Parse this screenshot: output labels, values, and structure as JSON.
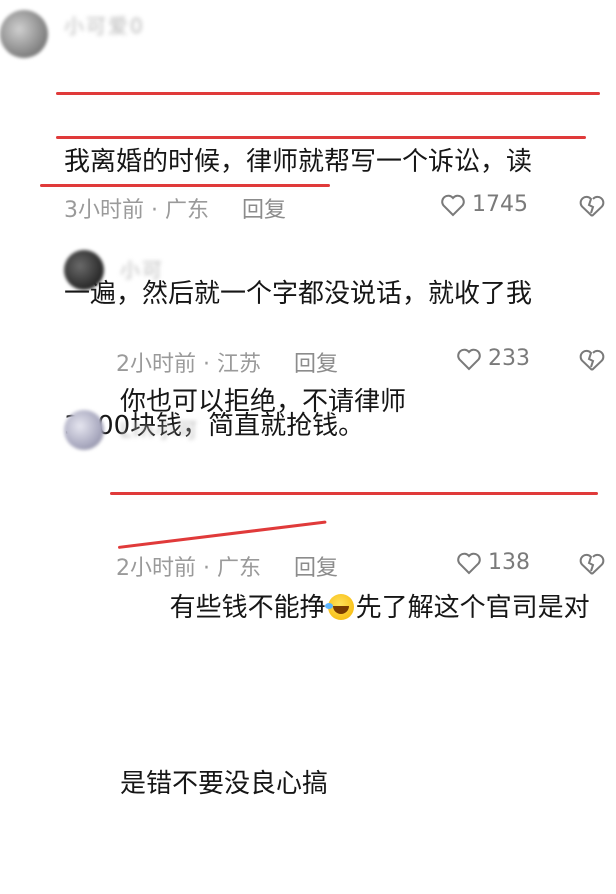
{
  "comments": [
    {
      "username": "小可爱0",
      "lines": [
        "我离婚的时候，律师就帮写一个诉讼，读",
        "一遍，然后就一个字都没说话，就收了我",
        "3000块钱，简直就抢钱。"
      ],
      "time": "3小时前",
      "location": "广东",
      "reply_label": "回复",
      "likes": "1745"
    },
    {
      "username": "小可",
      "lines": [
        "你也可以拒绝，不请律师"
      ],
      "time": "2小时前",
      "location": "江苏",
      "reply_label": "回复",
      "likes": "233"
    },
    {
      "username": "Lln小可",
      "lines_part1": "有些钱不能挣",
      "lines_part2": "先了解这个官司是对",
      "line2": "是错不要没良心搞",
      "time": "2小时前",
      "location": "广东",
      "reply_label": "回复",
      "likes": "138"
    }
  ],
  "separator": "·",
  "icons": {
    "like": "heart-outline-icon",
    "dislike": "heart-broken-outline-icon",
    "emoji": "laughing-tears-emoji-icon"
  },
  "colors": {
    "underline": "#e03a3a",
    "meta": "#9a9a9a"
  }
}
